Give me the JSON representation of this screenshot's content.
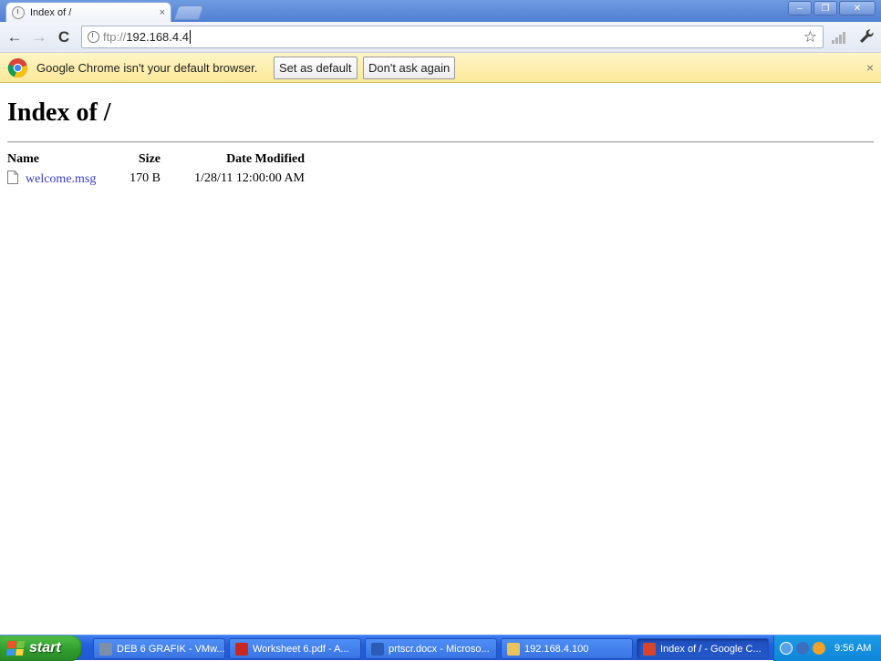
{
  "browser": {
    "tab": {
      "title": "Index of /",
      "close_glyph": "×"
    },
    "window_controls": {
      "minimize": "–",
      "restore": "❐",
      "close": "✕"
    },
    "toolbar": {
      "back_glyph": "←",
      "forward_glyph": "→",
      "reload_glyph": "C",
      "address_scheme": "ftp://",
      "address_host": "192.168.4.4",
      "star_glyph": "☆"
    },
    "infobar": {
      "message": "Google Chrome isn't your default browser.",
      "set_default_label": "Set as default",
      "dont_ask_label": "Don't ask again",
      "close_glyph": "×"
    }
  },
  "page": {
    "title": "Index of /",
    "columns": {
      "name": "Name",
      "size": "Size",
      "date": "Date Modified"
    },
    "files": [
      {
        "name": "welcome.msg",
        "size": "170 B",
        "date": "1/28/11 12:00:00 AM"
      }
    ]
  },
  "taskbar": {
    "start_label": "start",
    "tasks": [
      {
        "label": "DEB 6 GRAFIK - VMw...",
        "icon_color": "#7d8fa8"
      },
      {
        "label": "Worksheet 6.pdf - A...",
        "icon_color": "#c8281e"
      },
      {
        "label": "prtscr.docx - Microso...",
        "icon_color": "#2a5cb8"
      },
      {
        "label": "192.168.4.100",
        "icon_color": "#e9c45a"
      },
      {
        "label": "Index of / - Google C...",
        "icon_color": "#d9442a"
      }
    ],
    "clock": "9:56 AM"
  },
  "colors": {
    "link": "#3b3bd6",
    "infobar": "#fbe89a",
    "taskbar": "#245edb",
    "start": "#2f9a2d"
  }
}
